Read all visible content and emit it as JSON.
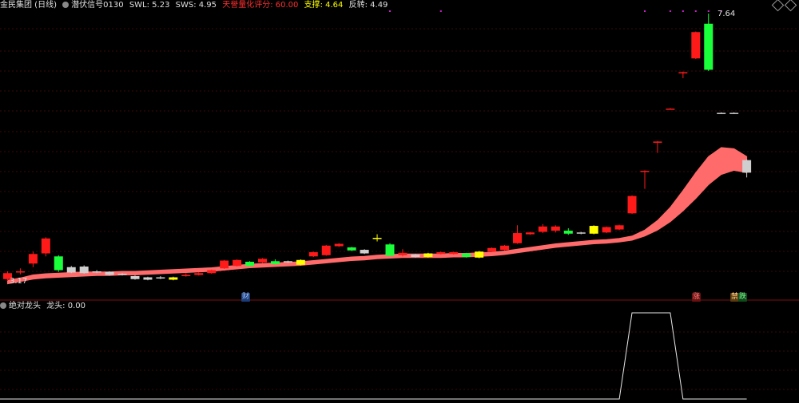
{
  "header": {
    "stock_name": "金民集团 (日线)",
    "indicator": "潜伏信号0130",
    "swl_label": "SWL: 5.23",
    "sws_label": "SWS: 4.95",
    "tianzhuang_label": "天誉量化评分: 60.00",
    "support_label": "支撑: 4.64",
    "reverse_label": "反转: 4.49",
    "colors": {
      "stock": "#e0e0e0",
      "swl": "#e0e0e0",
      "sws": "#e0e0e0",
      "tianzhuang": "#ff3030",
      "support": "#ffff00",
      "reverse": "#e0e0e0"
    }
  },
  "sub_header": {
    "indicator": "绝对龙头",
    "value_label": "龙头: 0.00"
  },
  "annotations": {
    "high_label": "7.64",
    "low_label": "3.17",
    "tag_cai": "财",
    "tag_zhang": "涨",
    "tag_jin": "禁",
    "tag_die": "跌"
  },
  "chart_data": {
    "type": "candlestick",
    "price_range": [
      3.0,
      8.0
    ],
    "candles": [
      {
        "o": 3.2,
        "c": 3.3,
        "h": 3.33,
        "l": 3.17,
        "color": "red"
      },
      {
        "o": 3.33,
        "c": 3.33,
        "h": 3.38,
        "l": 3.28,
        "color": "red"
      },
      {
        "o": 3.46,
        "c": 3.62,
        "h": 3.66,
        "l": 3.4,
        "color": "red"
      },
      {
        "o": 3.88,
        "c": 3.63,
        "h": 3.9,
        "l": 3.58,
        "color": "red"
      },
      {
        "o": 3.58,
        "c": 3.35,
        "h": 3.6,
        "l": 3.32,
        "color": "green"
      },
      {
        "o": 3.4,
        "c": 3.31,
        "h": 3.42,
        "l": 3.3,
        "color": "gray"
      },
      {
        "o": 3.41,
        "c": 3.3,
        "h": 3.43,
        "l": 3.29,
        "color": "gray"
      },
      {
        "o": 3.33,
        "c": 3.32,
        "h": 3.35,
        "l": 3.3,
        "color": "gray"
      },
      {
        "o": 3.32,
        "c": 3.27,
        "h": 3.33,
        "l": 3.26,
        "color": "gray"
      },
      {
        "o": 3.29,
        "c": 3.27,
        "h": 3.3,
        "l": 3.26,
        "color": "gray"
      },
      {
        "o": 3.25,
        "c": 3.2,
        "h": 3.26,
        "l": 3.19,
        "color": "gray"
      },
      {
        "o": 3.23,
        "c": 3.19,
        "h": 3.24,
        "l": 3.18,
        "color": "gray"
      },
      {
        "o": 3.21,
        "c": 3.23,
        "h": 3.25,
        "l": 3.2,
        "color": "gray"
      },
      {
        "o": 3.23,
        "c": 3.19,
        "h": 3.24,
        "l": 3.18,
        "color": "yellow"
      },
      {
        "o": 3.25,
        "c": 3.27,
        "h": 3.3,
        "l": 3.24,
        "color": "red"
      },
      {
        "o": 3.27,
        "c": 3.3,
        "h": 3.31,
        "l": 3.26,
        "color": "red"
      },
      {
        "o": 3.3,
        "c": 3.35,
        "h": 3.36,
        "l": 3.29,
        "color": "red"
      },
      {
        "o": 3.38,
        "c": 3.51,
        "h": 3.52,
        "l": 3.37,
        "color": "red"
      },
      {
        "o": 3.42,
        "c": 3.52,
        "h": 3.53,
        "l": 3.41,
        "color": "red"
      },
      {
        "o": 3.49,
        "c": 3.42,
        "h": 3.5,
        "l": 3.41,
        "color": "green"
      },
      {
        "o": 3.48,
        "c": 3.54,
        "h": 3.55,
        "l": 3.47,
        "color": "red"
      },
      {
        "o": 3.5,
        "c": 3.45,
        "h": 3.53,
        "l": 3.44,
        "color": "green"
      },
      {
        "o": 3.5,
        "c": 3.48,
        "h": 3.51,
        "l": 3.47,
        "color": "gray"
      },
      {
        "o": 3.52,
        "c": 3.44,
        "h": 3.53,
        "l": 3.43,
        "color": "yellow"
      },
      {
        "o": 3.58,
        "c": 3.65,
        "h": 3.66,
        "l": 3.57,
        "color": "red"
      },
      {
        "o": 3.6,
        "c": 3.76,
        "h": 3.77,
        "l": 3.59,
        "color": "red"
      },
      {
        "o": 3.75,
        "c": 3.79,
        "h": 3.8,
        "l": 3.74,
        "color": "red"
      },
      {
        "o": 3.73,
        "c": 3.68,
        "h": 3.74,
        "l": 3.67,
        "color": "green"
      },
      {
        "o": 3.69,
        "c": 3.63,
        "h": 3.7,
        "l": 3.62,
        "color": "gray"
      },
      {
        "o": 3.89,
        "c": 3.89,
        "h": 3.95,
        "l": 3.83,
        "color": "yellow"
      },
      {
        "o": 3.78,
        "c": 3.59,
        "h": 3.8,
        "l": 3.58,
        "color": "green"
      },
      {
        "o": 3.6,
        "c": 3.64,
        "h": 3.7,
        "l": 3.58,
        "color": "red"
      },
      {
        "o": 3.61,
        "c": 3.57,
        "h": 3.62,
        "l": 3.56,
        "color": "gray"
      },
      {
        "o": 3.57,
        "c": 3.63,
        "h": 3.64,
        "l": 3.56,
        "color": "yellow"
      },
      {
        "o": 3.62,
        "c": 3.65,
        "h": 3.66,
        "l": 3.61,
        "color": "red"
      },
      {
        "o": 3.62,
        "c": 3.65,
        "h": 3.66,
        "l": 3.61,
        "color": "red"
      },
      {
        "o": 3.63,
        "c": 3.57,
        "h": 3.64,
        "l": 3.56,
        "color": "green"
      },
      {
        "o": 3.66,
        "c": 3.56,
        "h": 3.67,
        "l": 3.55,
        "color": "yellow"
      },
      {
        "o": 3.66,
        "c": 3.72,
        "h": 3.73,
        "l": 3.65,
        "color": "red"
      },
      {
        "o": 3.69,
        "c": 3.76,
        "h": 3.77,
        "l": 3.68,
        "color": "red"
      },
      {
        "o": 3.8,
        "c": 3.97,
        "h": 4.1,
        "l": 3.79,
        "color": "red"
      },
      {
        "o": 3.95,
        "c": 3.98,
        "h": 3.99,
        "l": 3.94,
        "color": "red"
      },
      {
        "o": 3.99,
        "c": 4.08,
        "h": 4.12,
        "l": 3.97,
        "color": "red"
      },
      {
        "o": 4.01,
        "c": 4.08,
        "h": 4.1,
        "l": 3.98,
        "color": "red"
      },
      {
        "o": 4.01,
        "c": 3.96,
        "h": 4.05,
        "l": 3.94,
        "color": "green"
      },
      {
        "o": 3.98,
        "c": 3.96,
        "h": 3.99,
        "l": 3.95,
        "color": "gray"
      },
      {
        "o": 4.09,
        "c": 3.96,
        "h": 4.1,
        "l": 3.95,
        "color": "yellow"
      },
      {
        "o": 4.07,
        "c": 3.98,
        "h": 4.08,
        "l": 3.97,
        "color": "red"
      },
      {
        "o": 4.03,
        "c": 4.1,
        "h": 4.11,
        "l": 4.02,
        "color": "red"
      },
      {
        "o": 4.3,
        "c": 4.59,
        "h": 4.6,
        "l": 4.29,
        "color": "red"
      },
      {
        "o": 5.01,
        "c": 5.01,
        "h": 5.02,
        "l": 4.71,
        "color": "red"
      },
      {
        "o": 5.5,
        "c": 5.5,
        "h": 5.51,
        "l": 5.31,
        "color": "red"
      },
      {
        "o": 6.05,
        "c": 6.05,
        "h": 6.06,
        "l": 6.05,
        "color": "red"
      },
      {
        "o": 6.66,
        "c": 6.66,
        "h": 6.67,
        "l": 6.56,
        "color": "red"
      },
      {
        "o": 6.89,
        "c": 7.33,
        "h": 7.34,
        "l": 6.88,
        "color": "red"
      },
      {
        "o": 7.47,
        "c": 6.7,
        "h": 7.64,
        "l": 6.68,
        "color": "green"
      },
      {
        "o": 5.98,
        "c": 5.98,
        "h": 5.99,
        "l": 5.98,
        "color": "gray"
      },
      {
        "o": 5.98,
        "c": 5.98,
        "h": 5.99,
        "l": 5.98,
        "color": "gray"
      },
      {
        "o": 5.19,
        "c": 4.98,
        "h": 5.2,
        "l": 4.9,
        "color": "gray"
      }
    ],
    "band_upper": [
      3.18,
      3.22,
      3.27,
      3.29,
      3.3,
      3.31,
      3.32,
      3.32,
      3.32,
      3.33,
      3.33,
      3.34,
      3.35,
      3.36,
      3.37,
      3.38,
      3.39,
      3.41,
      3.43,
      3.45,
      3.46,
      3.47,
      3.48,
      3.49,
      3.51,
      3.53,
      3.55,
      3.57,
      3.58,
      3.6,
      3.61,
      3.62,
      3.62,
      3.62,
      3.62,
      3.63,
      3.63,
      3.64,
      3.65,
      3.67,
      3.7,
      3.73,
      3.76,
      3.79,
      3.81,
      3.83,
      3.85,
      3.86,
      3.88,
      3.92,
      4.02,
      4.18,
      4.4,
      4.68,
      4.98,
      5.25,
      5.4,
      5.38,
      5.25
    ],
    "band_lower": [
      3.12,
      3.16,
      3.2,
      3.22,
      3.23,
      3.24,
      3.25,
      3.26,
      3.26,
      3.27,
      3.27,
      3.28,
      3.29,
      3.3,
      3.31,
      3.32,
      3.33,
      3.35,
      3.37,
      3.39,
      3.4,
      3.41,
      3.42,
      3.43,
      3.45,
      3.47,
      3.49,
      3.51,
      3.52,
      3.54,
      3.55,
      3.56,
      3.56,
      3.56,
      3.56,
      3.57,
      3.57,
      3.58,
      3.59,
      3.61,
      3.64,
      3.67,
      3.7,
      3.73,
      3.75,
      3.77,
      3.79,
      3.8,
      3.82,
      3.85,
      3.92,
      4.02,
      4.16,
      4.34,
      4.55,
      4.78,
      4.95,
      5.02,
      4.98
    ],
    "sub_series": [
      0,
      0,
      0,
      0,
      0,
      0,
      0,
      0,
      0,
      0,
      0,
      0,
      0,
      0,
      0,
      0,
      0,
      0,
      0,
      0,
      0,
      0,
      0,
      0,
      0,
      0,
      0,
      0,
      0,
      0,
      0,
      0,
      0,
      0,
      0,
      0,
      0,
      0,
      0,
      0,
      0,
      0,
      0,
      0,
      0,
      0,
      0,
      0,
      0,
      1,
      1,
      1,
      1,
      0,
      0,
      0,
      0,
      0,
      0
    ],
    "sub_range": [
      0,
      1
    ]
  }
}
